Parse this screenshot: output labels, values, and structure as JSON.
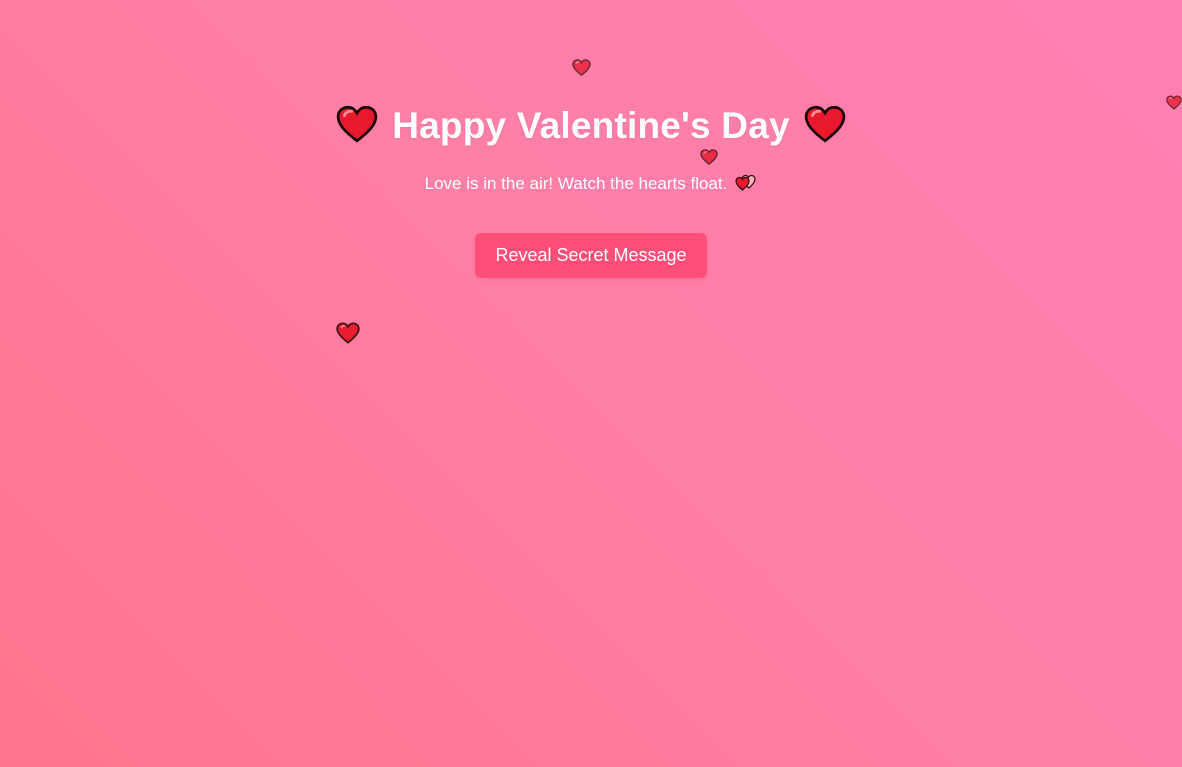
{
  "header": {
    "title": "Happy Valentine's Day",
    "subtitle": "Love is in the air! Watch the hearts float."
  },
  "actions": {
    "reveal_label": "Reveal Secret Message"
  },
  "icons": {
    "title_left": "red-heart-icon",
    "title_right": "red-heart-icon",
    "subtitle_trailing": "two-hearts-icon",
    "floating": "floating-heart-icon"
  },
  "colors": {
    "background_start": "#ff758c",
    "background_end": "#ff7eb3",
    "button": "#ff4f79",
    "heart_fill": "#e8192c",
    "text": "#ffffff"
  }
}
